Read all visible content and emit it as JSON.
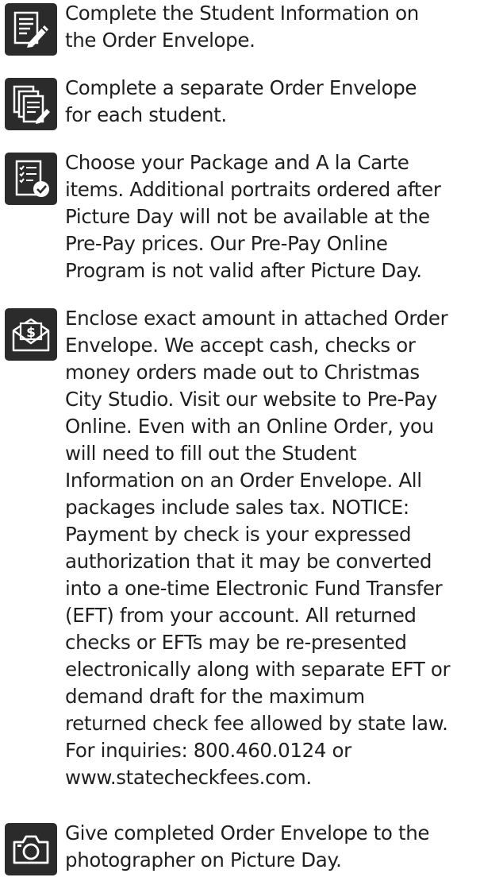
{
  "steps": [
    {
      "icon": "pencil-form-icon",
      "lines": [
        "Complete the Student Information on",
        "the Order Envelope."
      ]
    },
    {
      "icon": "stacked-documents-icon",
      "lines": [
        "Complete a separate Order Envelope",
        "for each student."
      ]
    },
    {
      "icon": "checklist-icon",
      "lines": [
        "Choose your Package and A la Carte",
        "items. Additional portraits ordered after",
        "Picture Day will not be available at the",
        "Pre-Pay prices. Our Pre-Pay Online",
        "Program is not valid after Picture Day."
      ]
    },
    {
      "icon": "envelope-dollar-icon",
      "lines": [
        "Enclose exact amount in attached Order",
        "Envelope. We accept cash, checks or",
        "money orders made out to Christmas",
        "City Studio. Visit our website to Pre-Pay",
        "Online. Even with an Online Order, you",
        "will need to fill out the Student",
        "Information on an Order Envelope. All",
        "packages include sales tax. NOTICE:",
        "Payment by check is your expressed",
        "authorization that it may be converted",
        "into a one-time Electronic Fund Transfer",
        "(EFT) from your account. All returned",
        "checks or EFTs may be re-presented",
        "electronically along with separate EFT or",
        "demand draft for the maximum",
        "returned check fee allowed by state law.",
        "For inquiries: 800.460.0124 or",
        "www.statecheckfees.com."
      ]
    },
    {
      "icon": "camera-icon",
      "lines": [
        "Give completed Order Envelope to the",
        "photographer on Picture Day."
      ]
    }
  ]
}
